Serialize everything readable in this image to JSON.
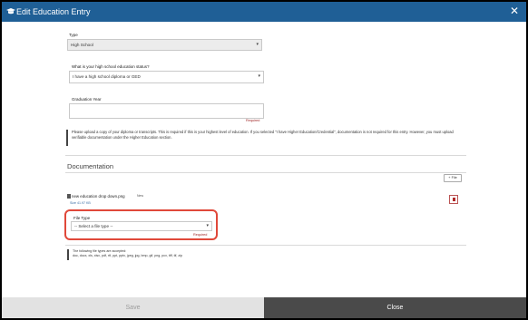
{
  "dialog": {
    "title": "Edit Education Entry",
    "close_glyph": "✕"
  },
  "form": {
    "type": {
      "label": "Type",
      "value": "High School"
    },
    "status": {
      "label": "What is your high school education status?",
      "value": "I have a high school diploma or GED"
    },
    "graduation": {
      "label": "Graduation Year",
      "value": "",
      "required": "Required"
    },
    "info": "Please upload a copy of your diploma or transcripts. This is required if this is your highest level of education. If you selected \"I have Higher Education/Credential\", documentation is not required for this entry. However, you must upload verifiable documentation under the Higher Education section."
  },
  "documentation": {
    "title": "Documentation",
    "add_file_label": "+ File",
    "file": {
      "name": "new education drop down.png",
      "badge": "New",
      "size": "Size 41.97 KB"
    },
    "file_type": {
      "label": "File Type",
      "placeholder": "-- Select a file type --",
      "required": "Required"
    },
    "types_note": "The following file types are accepted:",
    "types_list": "doc, docx, xls, xlsx, pdf, rtf, ppt, pptx, jpeg, jpg, bmp, gif, png, pcx, tiff, tif, zip"
  },
  "footer": {
    "save_label": "Save",
    "close_label": "Close"
  },
  "colors": {
    "header": "#1f5f96",
    "highlight": "#e0483a",
    "close_button": "#4a4a4a",
    "save_button": "#e2e2e2"
  }
}
